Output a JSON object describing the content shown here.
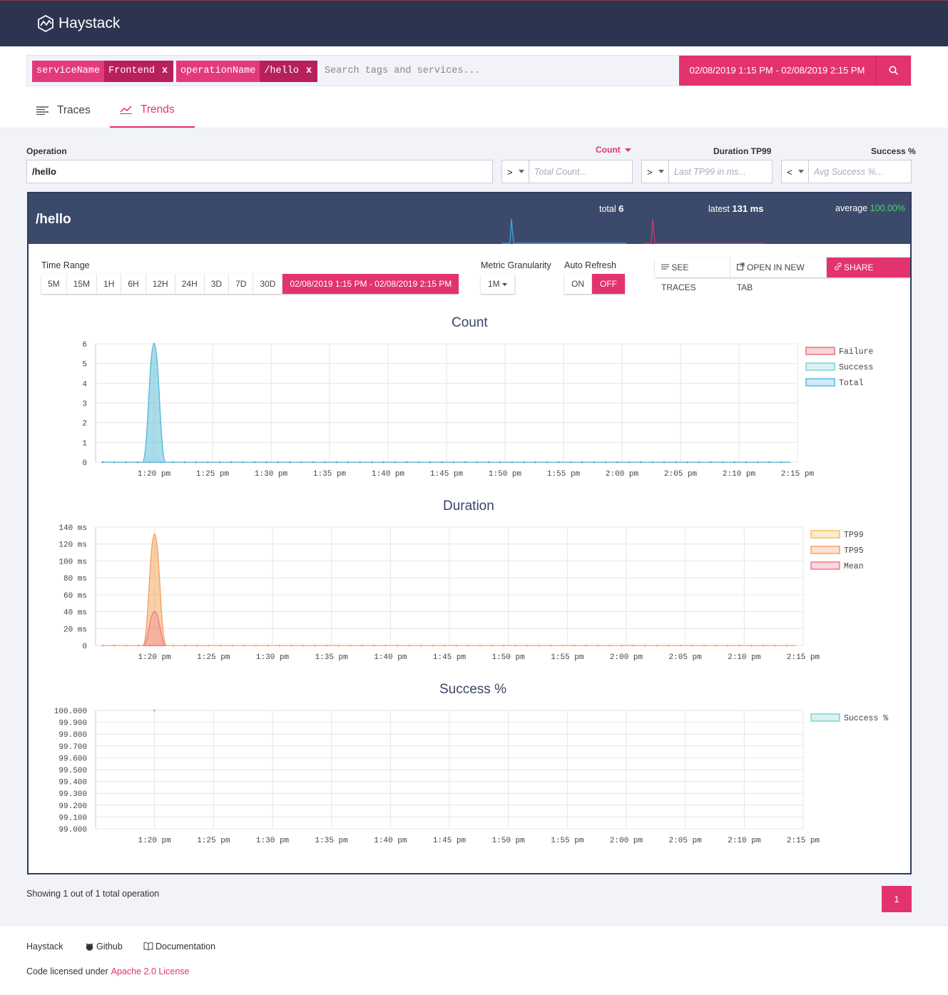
{
  "app": {
    "title": "Haystack"
  },
  "search": {
    "chips": [
      {
        "key": "serviceName",
        "value": "Frontend",
        "remove": "x"
      },
      {
        "key": "operationName",
        "value": "/hello",
        "remove": "x"
      }
    ],
    "placeholder": "Search tags and services...",
    "time_range": "02/08/2019 1:15 PM - 02/08/2019 2:15 PM"
  },
  "tabs": [
    {
      "label": "Traces"
    },
    {
      "label": "Trends"
    }
  ],
  "filters": {
    "operation_label": "Operation",
    "operation_value": "/hello",
    "count_label": "Count",
    "count_op": ">",
    "count_placeholder": "Total Count...",
    "duration_label": "Duration TP99",
    "duration_op": ">",
    "duration_placeholder": "Last TP99 in ms...",
    "success_label": "Success %",
    "success_op": "<",
    "success_placeholder": "Avg Success %..."
  },
  "card": {
    "title": "/hello",
    "total_label": "total",
    "total_value": "6",
    "latest_label": "latest",
    "latest_value": "131 ms",
    "average_label": "average",
    "average_value": "100.00%",
    "time_range_label": "Time Range",
    "ranges": [
      "5M",
      "15M",
      "1H",
      "6H",
      "12H",
      "24H",
      "3D",
      "7D",
      "30D"
    ],
    "active_range": "02/08/2019 1:15 PM - 02/08/2019 2:15 PM",
    "granularity_label": "Metric Granularity",
    "granularity_value": "1M",
    "refresh_label": "Auto Refresh",
    "refresh_on": "ON",
    "refresh_off": "OFF",
    "see_traces": "SEE TRACES",
    "open_new_tab": "OPEN IN NEW TAB",
    "share_trend": "SHARE TREND"
  },
  "colors": {
    "accent": "#e2336f",
    "navy": "#2c3450",
    "success": "#4bd36b"
  },
  "chart_data": [
    {
      "type": "area",
      "title": "Count",
      "x_ticks": [
        "1:20 pm",
        "1:25 pm",
        "1:30 pm",
        "1:35 pm",
        "1:40 pm",
        "1:45 pm",
        "1:50 pm",
        "1:55 pm",
        "2:00 pm",
        "2:05 pm",
        "2:10 pm",
        "2:15 pm"
      ],
      "y_ticks": [
        "0",
        "1",
        "2",
        "3",
        "4",
        "5",
        "6"
      ],
      "ylim": [
        0,
        6
      ],
      "x_range_minutes_after_1_15pm": [
        0,
        60
      ],
      "series": [
        {
          "name": "Failure",
          "color": "#e8717f",
          "x": [
            0,
            60
          ],
          "values": [
            0,
            0
          ]
        },
        {
          "name": "Success",
          "color": "#7fd3cf",
          "x": [
            4,
            5,
            6
          ],
          "values": [
            0,
            6,
            0
          ]
        },
        {
          "name": "Total",
          "color": "#5bb8e0",
          "x": [
            4,
            5,
            6
          ],
          "values": [
            0,
            6,
            0
          ]
        }
      ]
    },
    {
      "type": "area",
      "title": "Duration",
      "x_ticks": [
        "1:20 pm",
        "1:25 pm",
        "1:30 pm",
        "1:35 pm",
        "1:40 pm",
        "1:45 pm",
        "1:50 pm",
        "1:55 pm",
        "2:00 pm",
        "2:05 pm",
        "2:10 pm",
        "2:15 pm"
      ],
      "y_ticks": [
        "0",
        "20 ms",
        "40 ms",
        "60 ms",
        "80 ms",
        "100 ms",
        "120 ms",
        "140 ms"
      ],
      "ylim": [
        0,
        140
      ],
      "series": [
        {
          "name": "TP99",
          "color": "#f5c15c",
          "x": [
            4,
            5,
            6
          ],
          "values": [
            0,
            131,
            0
          ]
        },
        {
          "name": "TP95",
          "color": "#f5a06b",
          "x": [
            4,
            5,
            6
          ],
          "values": [
            0,
            131,
            0
          ]
        },
        {
          "name": "Mean",
          "color": "#ee7a8f",
          "x": [
            4,
            5,
            6
          ],
          "values": [
            0,
            40,
            0
          ]
        }
      ]
    },
    {
      "type": "scatter",
      "title": "Success %",
      "x_ticks": [
        "1:20 pm",
        "1:25 pm",
        "1:30 pm",
        "1:35 pm",
        "1:40 pm",
        "1:45 pm",
        "1:50 pm",
        "1:55 pm",
        "2:00 pm",
        "2:05 pm",
        "2:10 pm",
        "2:15 pm"
      ],
      "y_ticks": [
        "99.000",
        "99.100",
        "99.200",
        "99.300",
        "99.400",
        "99.500",
        "99.600",
        "99.700",
        "99.800",
        "99.900",
        "100.000"
      ],
      "ylim": [
        99,
        100
      ],
      "series": [
        {
          "name": "Success %",
          "color": "#7fd3cf",
          "x": [
            5
          ],
          "values": [
            100
          ]
        }
      ]
    }
  ],
  "pagination": {
    "showing": "Showing 1 out of 1 total operation",
    "page": "1"
  },
  "footer": {
    "haystack": "Haystack",
    "github": "Github",
    "documentation": "Documentation",
    "license_prefix": "Code licensed under",
    "license_link": "Apache 2.0 License"
  }
}
